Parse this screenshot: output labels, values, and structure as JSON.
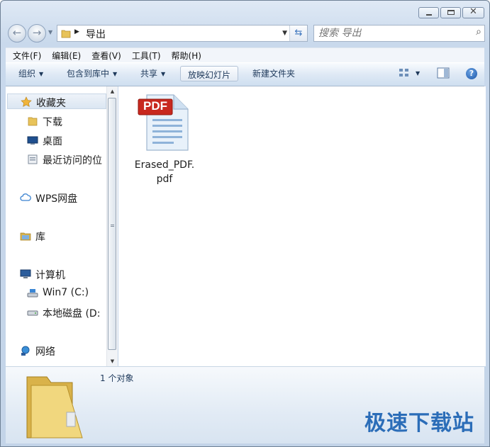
{
  "window": {
    "address_path": "导出",
    "search_placeholder": "搜索 导出"
  },
  "menu": {
    "items": [
      {
        "label": "文件(F)"
      },
      {
        "label": "编辑(E)"
      },
      {
        "label": "查看(V)"
      },
      {
        "label": "工具(T)"
      },
      {
        "label": "帮助(H)"
      }
    ]
  },
  "toolbar": {
    "organize": "组织",
    "include_in_library": "包含到库中",
    "share": "共享",
    "slideshow": "放映幻灯片",
    "new_folder": "新建文件夹"
  },
  "navpane": {
    "favorites": "收藏夹",
    "downloads": "下载",
    "desktop": "桌面",
    "recent": "最近访问的位",
    "wps_cloud": "WPS网盘",
    "libraries": "库",
    "computer": "计算机",
    "drive_c": "Win7 (C:)",
    "drive_d": "本地磁盘 (D:",
    "network": "网络"
  },
  "files": [
    {
      "name": "Erased_PDF.pdf",
      "badge": "PDF",
      "icon": "pdf-file-icon"
    }
  ],
  "details": {
    "count": "1 个对象"
  },
  "watermark": "极速下载站",
  "colors": {
    "pdf_red": "#c8281e",
    "folder_yellow": "#e8c35a",
    "link_blue": "#2b6db8"
  }
}
